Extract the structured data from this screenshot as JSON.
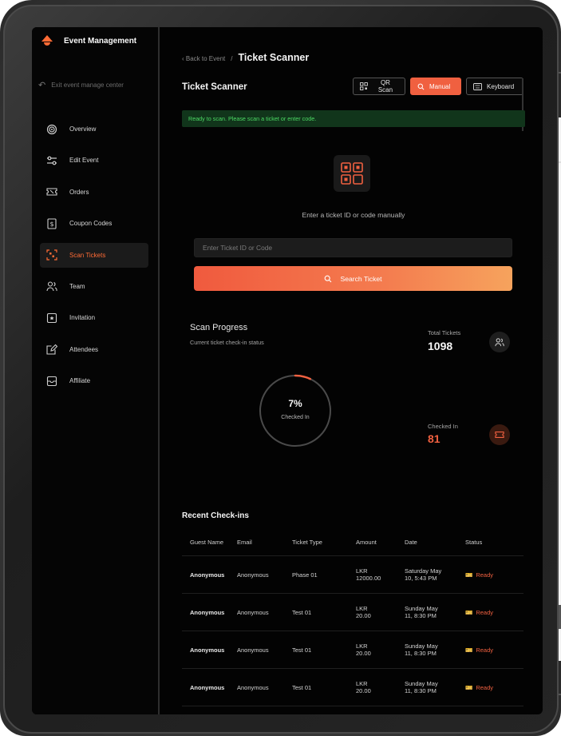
{
  "brand": {
    "name": "Event Management"
  },
  "sidebar": {
    "exit_label": "Exit event manage center",
    "items": [
      {
        "label": "Overview",
        "icon": "target-icon"
      },
      {
        "label": "Edit Event",
        "icon": "sliders-icon"
      },
      {
        "label": "Orders",
        "icon": "ticket-icon"
      },
      {
        "label": "Coupon Codes",
        "icon": "dollar-icon"
      },
      {
        "label": "Scan Tickets",
        "icon": "scan-icon",
        "active": true
      },
      {
        "label": "Team",
        "icon": "users-icon"
      },
      {
        "label": "Invitation",
        "icon": "invitation-icon"
      },
      {
        "label": "Attendees",
        "icon": "edit-icon"
      },
      {
        "label": "Affiliate",
        "icon": "inbox-icon"
      }
    ]
  },
  "breadcrumb": {
    "back": "Back to Event",
    "separator": "/",
    "current": "Ticket Scanner"
  },
  "scanner": {
    "title": "Ticket Scanner",
    "modes": {
      "qr": "QR Scan",
      "manual": "Manual",
      "keyboard": "Keyboard"
    },
    "active_mode": "Manual",
    "status_message": "Ready to scan. Please scan a ticket or enter code.",
    "hint": "Enter a ticket ID or code manually",
    "input_placeholder": "Enter Ticket ID or Code",
    "search_label": "Search Ticket"
  },
  "progress": {
    "title": "Scan Progress",
    "subtitle": "Current ticket check-in status",
    "percent_label": "7%",
    "percent": 7,
    "checked_label": "Checked In",
    "total_label": "Total Tickets",
    "total_value": "1098",
    "checked_in_label": "Checked In",
    "checked_in_value": "81"
  },
  "recent": {
    "title": "Recent Check-ins",
    "columns": [
      "Guest Name",
      "Email",
      "Ticket Type",
      "Amount",
      "Date",
      "Status"
    ],
    "rows": [
      {
        "guest": "Anonymous",
        "email": "Anonymous",
        "type": "Phase 01",
        "amount_cur": "LKR",
        "amount": "12000.00",
        "date1": "Saturday May",
        "date2": "10, 5:43 PM",
        "status": "Ready"
      },
      {
        "guest": "Anonymous",
        "email": "Anonymous",
        "type": "Test 01",
        "amount_cur": "LKR",
        "amount": "20.00",
        "date1": "Sunday May",
        "date2": "11, 8:30 PM",
        "status": "Ready"
      },
      {
        "guest": "Anonymous",
        "email": "Anonymous",
        "type": "Test 01",
        "amount_cur": "LKR",
        "amount": "20.00",
        "date1": "Sunday May",
        "date2": "11, 8:30 PM",
        "status": "Ready"
      },
      {
        "guest": "Anonymous",
        "email": "Anonymous",
        "type": "Test 01",
        "amount_cur": "LKR",
        "amount": "20.00",
        "date1": "Sunday May",
        "date2": "11, 8:30 PM",
        "status": "Ready"
      }
    ]
  },
  "colors": {
    "accent": "#f06040",
    "success_bg": "#11351b",
    "success_text": "#4cd964",
    "background": "#030303"
  }
}
